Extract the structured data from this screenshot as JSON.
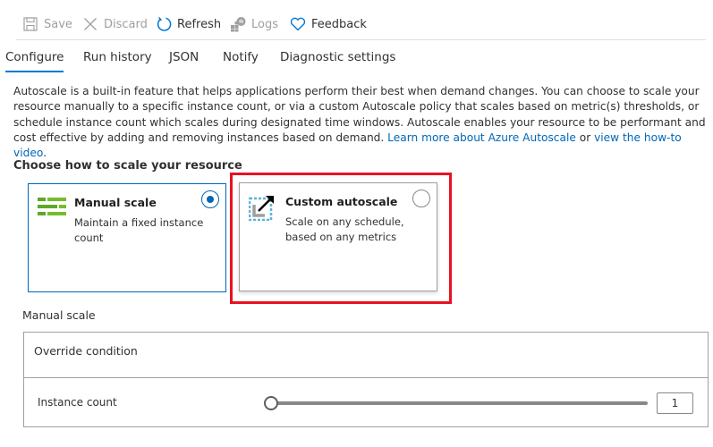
{
  "toolbar": {
    "save_label": "Save",
    "discard_label": "Discard",
    "refresh_label": "Refresh",
    "logs_label": "Logs",
    "feedback_label": "Feedback"
  },
  "tabs": [
    {
      "label": "Configure",
      "active": true
    },
    {
      "label": "Run history",
      "active": false
    },
    {
      "label": "JSON",
      "active": false
    },
    {
      "label": "Notify",
      "active": false
    },
    {
      "label": "Diagnostic settings",
      "active": false
    }
  ],
  "description": {
    "text": "Autoscale is a built-in feature that helps applications perform their best when demand changes. You can choose to scale your resource manually to a specific instance count, or via a custom Autoscale policy that scales based on metric(s) thresholds, or schedule instance count which scales during designated time windows. Autoscale enables your resource to be performant and cost effective by adding and removing instances based on demand. ",
    "link1": "Learn more about Azure Autoscale",
    "connector": " or ",
    "link2": "view the how-to video",
    "end": "."
  },
  "scale_section": {
    "title": "Choose how to scale your resource",
    "options": [
      {
        "title": "Manual scale",
        "subtitle": "Maintain a fixed instance count",
        "selected": true
      },
      {
        "title": "Custom autoscale",
        "subtitle": "Scale on any schedule, based on any metrics",
        "selected": false
      }
    ]
  },
  "manual_scale": {
    "label": "Manual scale",
    "override_condition": "Override condition",
    "instance_count_label": "Instance count",
    "instance_count_value": "1",
    "slider_fraction": 0
  },
  "colors": {
    "accent": "#0078d4",
    "link": "#0067b8",
    "highlight": "#e81123",
    "manual_icon_green": "#5ea928",
    "custom_icon_blue": "#59b4d9"
  }
}
